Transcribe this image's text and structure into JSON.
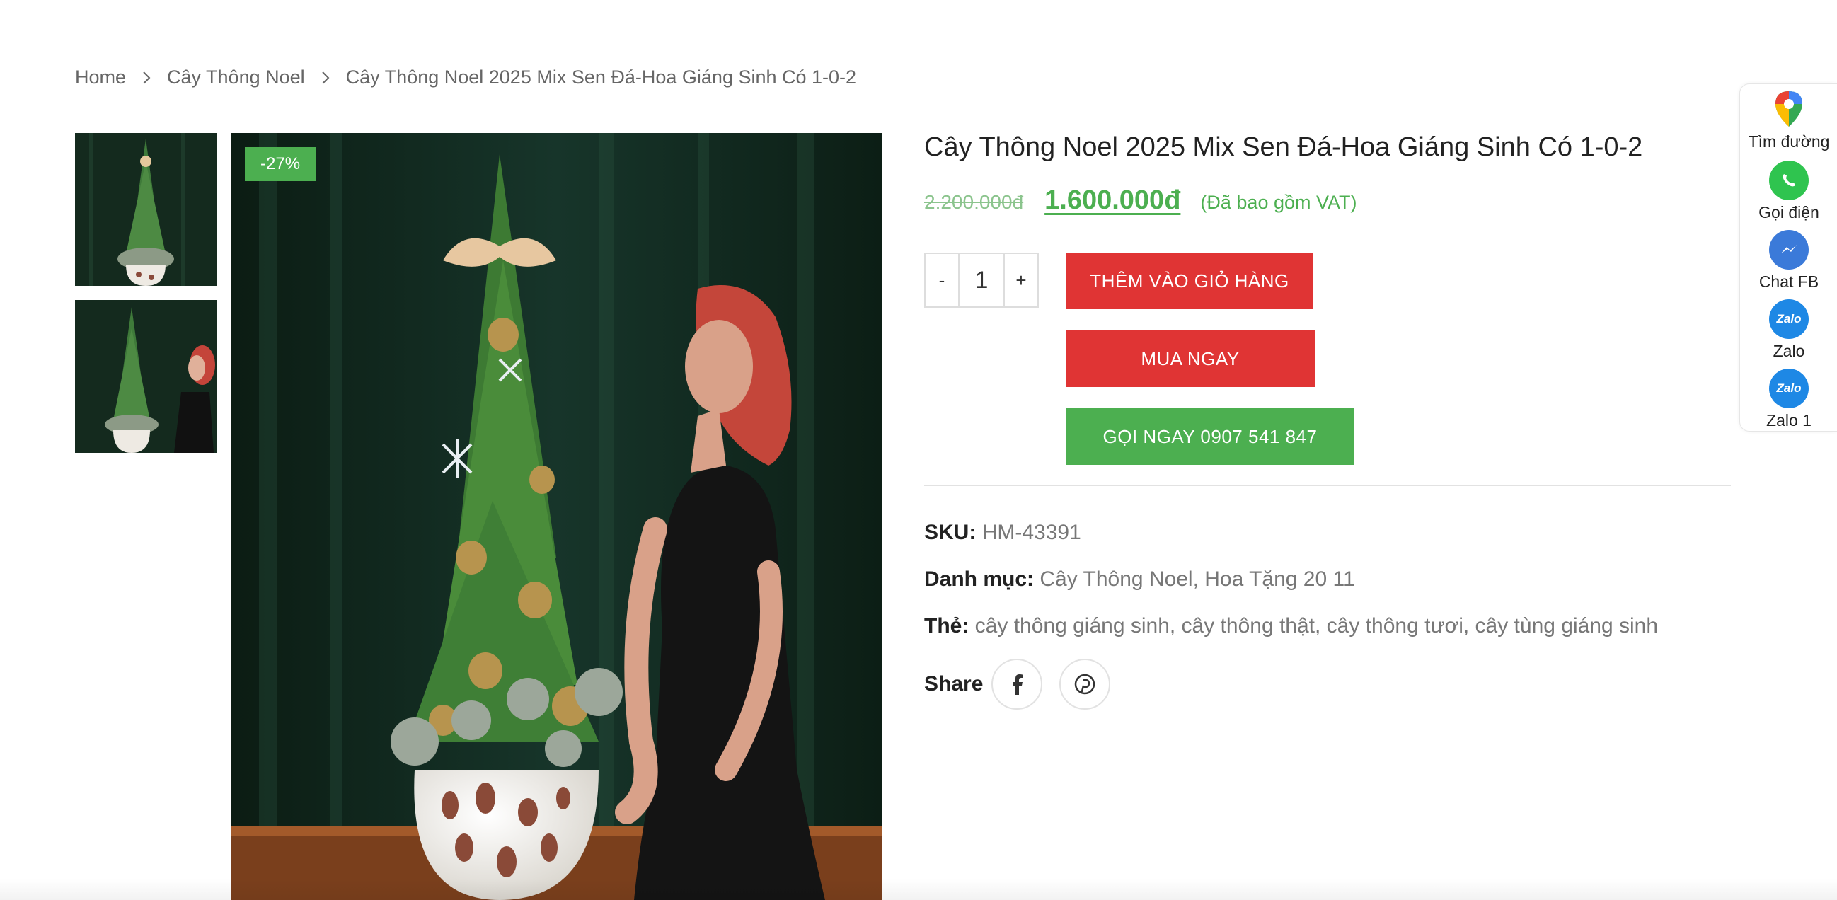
{
  "breadcrumb": {
    "items": [
      "Home",
      "Cây Thông Noel",
      "Cây Thông Noel 2025 Mix Sen Đá-Hoa Giáng Sinh Có 1-0-2"
    ]
  },
  "gallery": {
    "badge": "-27%"
  },
  "product": {
    "title": "Cây Thông Noel 2025 Mix Sen Đá-Hoa Giáng Sinh Có 1-0-2",
    "old_price": "2.200.000đ",
    "new_price": "1.600.000đ",
    "vat_note": "(Đã bao gồm VAT)",
    "quantity": "1",
    "qty_minus": "-",
    "qty_plus": "+",
    "add_to_cart": "THÊM VÀO GIỎ HÀNG",
    "buy_now": "MUA NGAY",
    "call_now": "GỌI NGAY 0907 541 847",
    "sku_label": "SKU:",
    "sku_value": "HM-43391",
    "category_label": "Danh mục:",
    "category_value": "Cây Thông Noel, Hoa Tặng 20 11",
    "tags_label": "Thẻ:",
    "tags_value": "cây thông giáng sinh, cây thông thật, cây thông tươi, cây tùng giáng sinh",
    "share_label": "Share"
  },
  "contact_bar": {
    "items": [
      {
        "label": "Tìm đường",
        "icon": "google-maps-icon"
      },
      {
        "label": "Gọi điện",
        "icon": "whatsapp-icon"
      },
      {
        "label": "Chat FB",
        "icon": "messenger-icon"
      },
      {
        "label": "Zalo",
        "icon": "zalo-icon",
        "badge": "Zalo"
      },
      {
        "label": "Zalo 1",
        "icon": "zalo-icon",
        "badge": "Zalo"
      }
    ]
  },
  "colors": {
    "primary_red": "#e03434",
    "primary_green": "#4caf50",
    "messenger_blue": "#3b7ad9",
    "zalo_blue": "#1e88e5"
  }
}
